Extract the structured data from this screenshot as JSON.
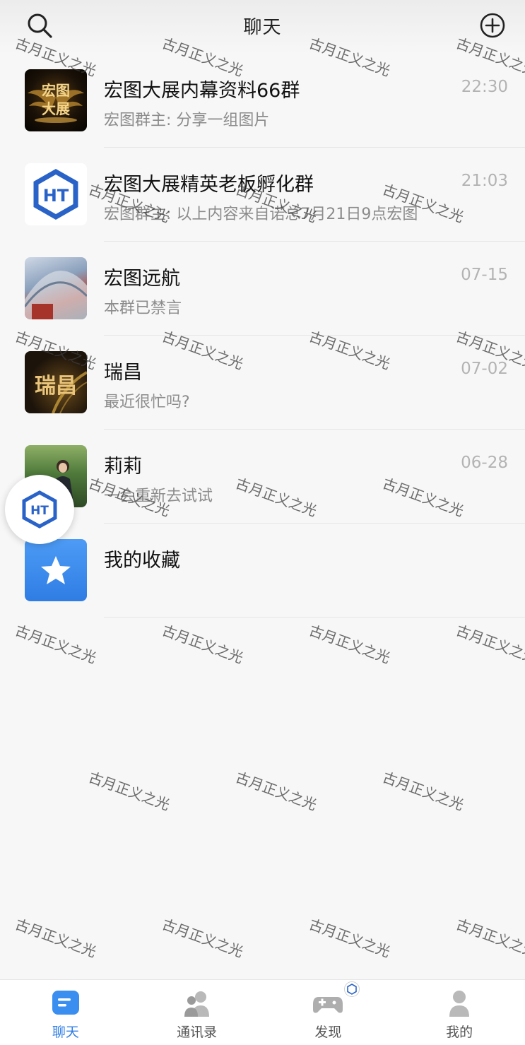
{
  "header": {
    "title": "聊天"
  },
  "chats": [
    {
      "name": "宏图大展内幕资料66群",
      "preview": "宏图群主: 分享一组图片",
      "time": "22:30",
      "avatar_text": [
        "宏图",
        "大展"
      ]
    },
    {
      "name": "宏图大展精英老板孵化群",
      "preview": "宏图群主: 以上内容来自诺总7月21日9点宏图",
      "time": "21:03",
      "avatar_text": [
        "HT"
      ]
    },
    {
      "name": "宏图远航",
      "preview": "本群已禁言",
      "time": "07-15"
    },
    {
      "name": "瑞昌",
      "preview": "最近很忙吗?",
      "time": "07-02",
      "avatar_text": [
        "瑞昌"
      ]
    },
    {
      "name": "莉莉",
      "preview": "一会重新去试试",
      "time": "06-28"
    },
    {
      "name": "我的收藏",
      "preview": "",
      "time": ""
    }
  ],
  "watermark": "古月正义之光",
  "tabs": [
    {
      "label": "聊天",
      "icon": "chat-icon",
      "active": true
    },
    {
      "label": "通讯录",
      "icon": "contacts-icon",
      "active": false
    },
    {
      "label": "发现",
      "icon": "discover-gamepad-icon",
      "active": false
    },
    {
      "label": "我的",
      "icon": "profile-icon",
      "active": false
    }
  ],
  "colors": {
    "accent": "#2f7de4",
    "background": "#f7f7f7",
    "muted": "#8c8c8c",
    "brand": "#2a63c7"
  }
}
